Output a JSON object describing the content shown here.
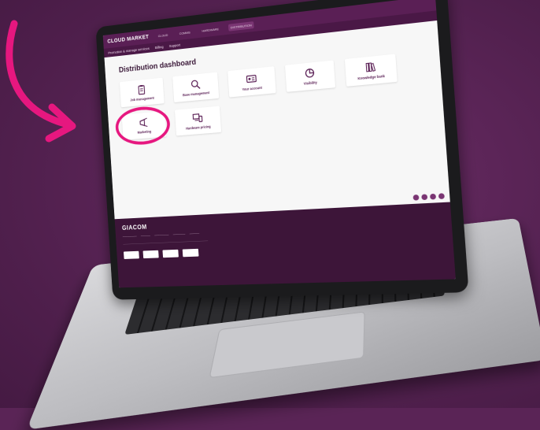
{
  "topbar": {
    "brand": "CLOUD MARKET",
    "nav": [
      "CLOUD",
      "COMMS",
      "HARDWARE",
      "DISTRIBUTION"
    ],
    "active": "DISTRIBUTION"
  },
  "subbar": {
    "items": [
      "Promotion & manage services",
      "Billing",
      "Support"
    ]
  },
  "dashboard": {
    "title": "Distribution dashboard",
    "tiles": [
      {
        "label": "Job management",
        "icon": "clipboard-icon"
      },
      {
        "label": "Base management",
        "icon": "magnifier-icon"
      },
      {
        "label": "Your account",
        "icon": "id-card-icon"
      },
      {
        "label": "Visibility",
        "icon": "pie-chart-icon"
      },
      {
        "label": "Knowledge bank",
        "icon": "books-icon"
      },
      {
        "label": "Marketing",
        "icon": "megaphone-icon"
      },
      {
        "label": "Hardware pricing",
        "icon": "devices-icon"
      }
    ],
    "highlighted": "Marketing"
  },
  "footer": {
    "logo": "GIACOM"
  },
  "colors": {
    "brand_purple": "#5a1f55",
    "highlight_pink": "#e6177f",
    "background": "#5a2456"
  }
}
